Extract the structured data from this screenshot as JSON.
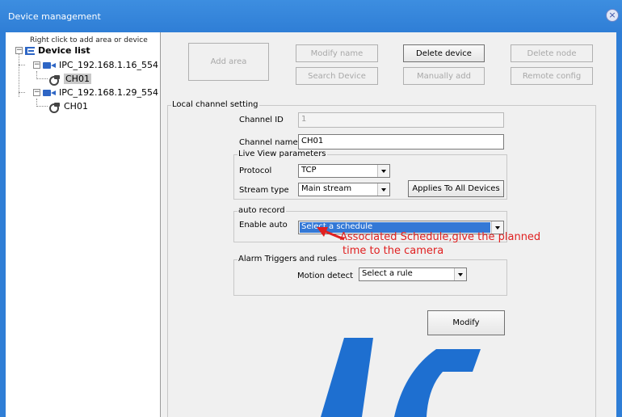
{
  "window": {
    "title": "Device management",
    "close_symbol": "×"
  },
  "tree": {
    "hint": "Right click to add area or device",
    "root_label": "Device list",
    "devices": [
      {
        "label": "IPC_192.168.1.16_554",
        "channel": "CH01"
      },
      {
        "label": "IPC_192.168.1.29_554",
        "channel": "CH01"
      }
    ]
  },
  "toolbar": {
    "add_area": "Add area",
    "modify_name": "Modify name",
    "delete_device": "Delete device",
    "delete_node": "Delete node",
    "search_device": "Search Device",
    "manually_add": "Manually add",
    "remote_config": "Remote config"
  },
  "local_channel": {
    "legend": "Local channel setting",
    "channel_id_label": "Channel ID",
    "channel_id_value": "1",
    "channel_name_label": "Channel name",
    "channel_name_value": "CH01",
    "live_view": {
      "legend": "Live View parameters",
      "protocol_label": "Protocol",
      "protocol_value": "TCP",
      "stream_type_label": "Stream type",
      "stream_type_value": "Main stream",
      "apply_all_button": "Applies To All Devices"
    },
    "auto_record": {
      "legend": "auto record",
      "enable_label": "Enable auto",
      "schedule_value": "Select a schedule"
    },
    "alarm": {
      "legend": "Alarm Triggers and rules",
      "motion_label": "Motion detect",
      "rule_value": "Select a rule"
    },
    "modify_button": "Modify"
  },
  "annotation": {
    "line1": "Associated Schedule,give the planned",
    "line2": "time to the camera",
    "color": "#e02020"
  },
  "colors": {
    "titlebar": "#2f7ed6",
    "selection": "#3378d6",
    "watermark": "#1e6fd0"
  }
}
